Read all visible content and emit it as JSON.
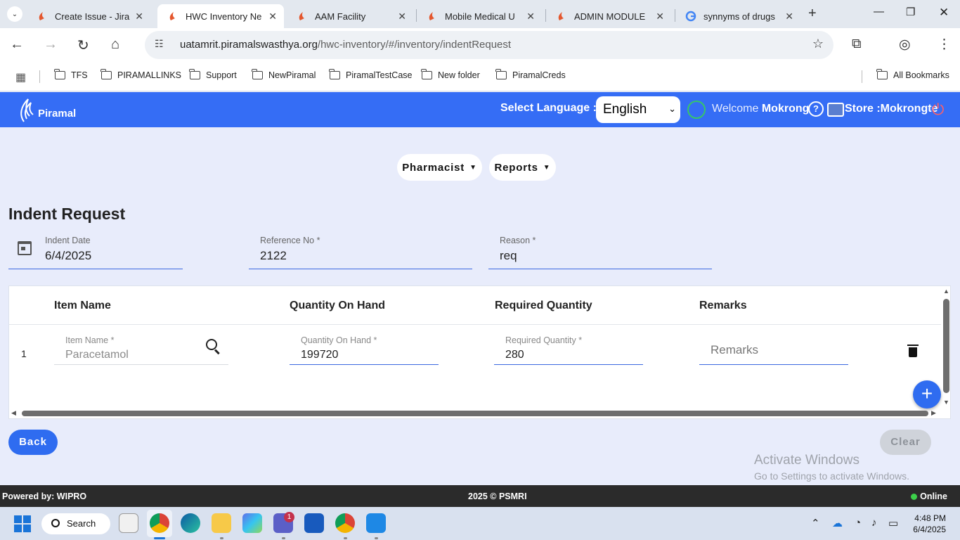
{
  "browser": {
    "tabs": [
      {
        "title": "Create Issue - Jira",
        "favicon": "piramal-logo"
      },
      {
        "title": "HWC Inventory Ne",
        "favicon": "piramal-logo",
        "active": true
      },
      {
        "title": "AAM Facility",
        "favicon": "piramal-logo"
      },
      {
        "title": "Mobile Medical U",
        "favicon": "piramal-logo"
      },
      {
        "title": "ADMIN MODULE",
        "favicon": "piramal-logo"
      },
      {
        "title": "synnyms of drugs",
        "favicon": "google-logo"
      }
    ],
    "url_host": "uatamrit.piramalswasthya.org",
    "url_path": "/hwc-inventory/#/inventory/indentRequest",
    "bookmarks": [
      "TFS",
      "PIRAMALLINKS",
      "Support",
      "NewPiramal",
      "PiramalTestCase",
      "New folder",
      "PiramalCreds"
    ],
    "all_bookmarks": "All Bookmarks"
  },
  "header": {
    "brand": "Piramal",
    "select_language_label": "Select Language :",
    "language": "English",
    "welcome_prefix": "Welcome ",
    "user_name": "Mokrong",
    "store": "Store :Mokrongte",
    "accent_color": "#356df5"
  },
  "menu": {
    "pharmacist": "Pharmacist",
    "reports": "Reports"
  },
  "page": {
    "title": "Indent Request"
  },
  "form": {
    "indent_date_label": "Indent Date",
    "indent_date": "6/4/2025",
    "reference_label": "Reference No *",
    "reference": "2122",
    "reason_label": "Reason *",
    "reason": "req"
  },
  "table": {
    "columns": [
      "Item Name",
      "Quantity On Hand",
      "Required Quantity",
      "Remarks"
    ],
    "rows": [
      {
        "index": "1",
        "item_name_label": "Item Name *",
        "item_name": "Paracetamol",
        "qoh_label": "Quantity On Hand *",
        "qoh": "199720",
        "req_label": "Required Quantity *",
        "req": "280",
        "remarks_placeholder": "Remarks"
      }
    ]
  },
  "actions": {
    "back": "Back",
    "clear": "Clear"
  },
  "watermark": {
    "line1": "Activate Windows",
    "line2": "Go to Settings to activate Windows."
  },
  "footer": {
    "powered": "Powered by: WIPRO",
    "copyright": "2025 © PSMRI",
    "status": "Online"
  },
  "taskbar": {
    "search": "Search",
    "teams_badge": "1",
    "time": "4:48 PM",
    "date": "6/4/2025"
  }
}
